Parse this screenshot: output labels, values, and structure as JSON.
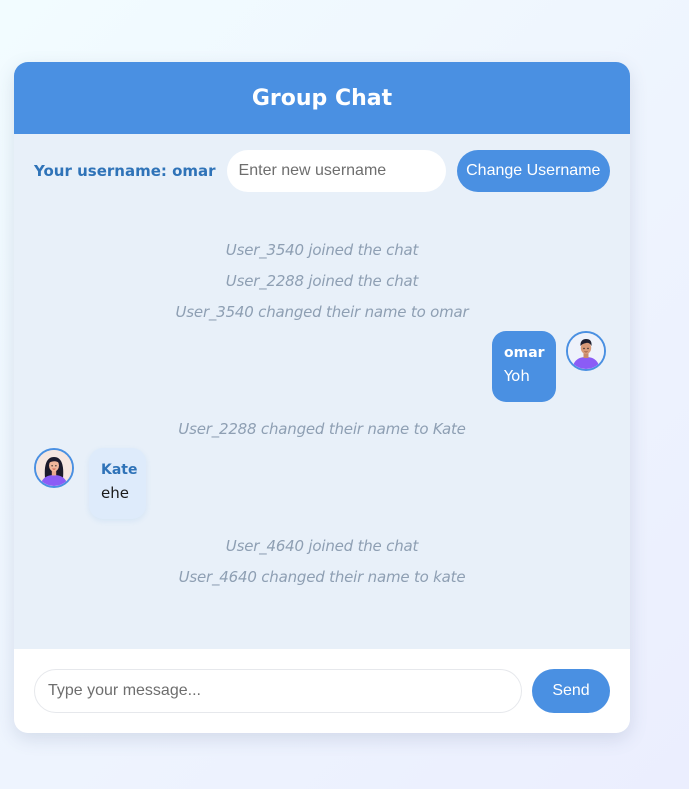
{
  "header": {
    "title": "Group Chat"
  },
  "username_bar": {
    "label": "Your username: omar",
    "input_placeholder": "Enter new username",
    "input_value": "",
    "button_label": "Change Username"
  },
  "messages": {
    "system_1": "User_3540 joined the chat",
    "system_2": "User_2288 joined the chat",
    "system_3": "User_3540 changed their name to omar",
    "msg_omar": {
      "sender": "omar",
      "text": "Yoh",
      "avatar": "man-avatar-icon"
    },
    "system_4": "User_2288 changed their name to Kate",
    "msg_kate": {
      "sender": "Kate",
      "text": "ehe",
      "avatar": "woman-avatar-icon"
    },
    "system_5": "User_4640 joined the chat",
    "system_6": "User_4640 changed their name to kate"
  },
  "composer": {
    "placeholder": "Type your message...",
    "value": "",
    "send_label": "Send"
  },
  "colors": {
    "accent": "#4a90e2",
    "panel": "#e8f0f9",
    "system_text": "#8e9fb3"
  }
}
